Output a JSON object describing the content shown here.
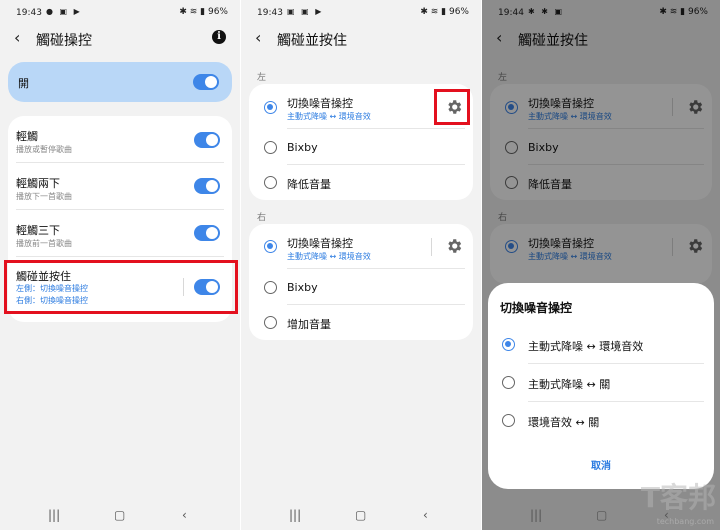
{
  "screen1": {
    "time": "19:43",
    "battery": "96%",
    "title": "觸碰操控",
    "master": {
      "label": "開"
    },
    "items": [
      {
        "label": "輕觸",
        "sub": "播放或暫停歌曲"
      },
      {
        "label": "輕觸兩下",
        "sub": "播放下一首歌曲"
      },
      {
        "label": "輕觸三下",
        "sub": "播放前一首歌曲"
      }
    ],
    "hold": {
      "label": "觸碰並按住",
      "left": "左側：切換噪音操控",
      "right": "右側：切換噪音操控"
    }
  },
  "screen2": {
    "time": "19:43",
    "battery": "96%",
    "title": "觸碰並按住",
    "left_section": "左",
    "right_section": "右",
    "left_options": [
      {
        "label": "切換噪音操控",
        "sub": "主動式降噪 ↔ 環境音效"
      },
      {
        "label": "Bixby"
      },
      {
        "label": "降低音量"
      }
    ],
    "right_options": [
      {
        "label": "切換噪音操控",
        "sub": "主動式降噪 ↔ 環境音效"
      },
      {
        "label": "Bixby"
      },
      {
        "label": "增加音量"
      }
    ]
  },
  "screen3": {
    "time": "19:44",
    "battery": "96%",
    "title": "觸碰並按住",
    "left_section": "左",
    "right_section": "右",
    "left_options": [
      {
        "label": "切換噪音操控",
        "sub": "主動式降噪 ↔ 環境音效"
      },
      {
        "label": "Bixby"
      },
      {
        "label": "降低音量"
      }
    ],
    "right_options": [
      {
        "label": "切換噪音操控",
        "sub": "主動式降噪 ↔ 環境音效"
      }
    ],
    "dialog": {
      "title": "切換噪音操控",
      "options": [
        "主動式降噪 ↔ 環境音效",
        "主動式降噪 ↔ 關",
        "環境音效 ↔ 關"
      ],
      "cancel": "取消"
    }
  },
  "watermark": {
    "text": "techbang.com",
    "logo": "T客邦"
  },
  "colors": {
    "accent": "#3e86e8",
    "highlight": "#e3101e",
    "master_bg": "#b9d7f7"
  }
}
